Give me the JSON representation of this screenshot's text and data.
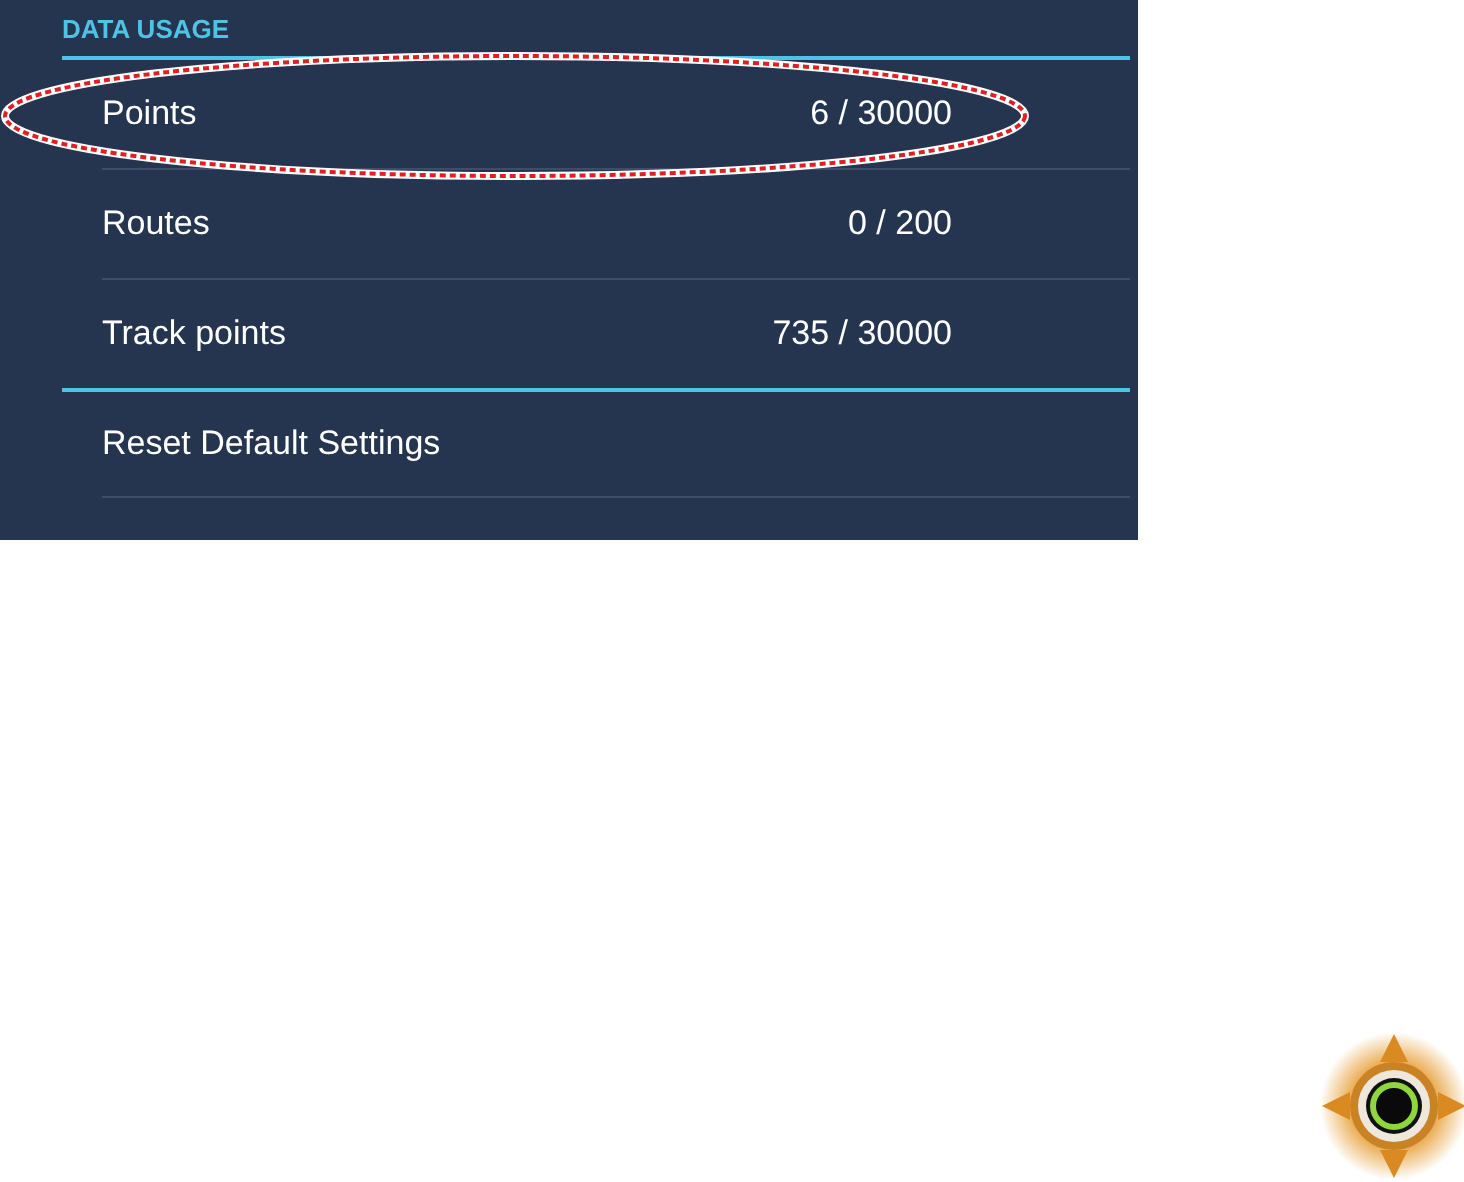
{
  "section": {
    "title": "DATA USAGE",
    "rows": [
      {
        "label": "Points",
        "value": "6 / 30000",
        "highlighted": true
      },
      {
        "label": "Routes",
        "value": "0 / 200",
        "highlighted": false
      },
      {
        "label": "Track points",
        "value": "735 / 30000",
        "highlighted": false
      }
    ]
  },
  "actions": [
    {
      "label": "Reset Default Settings"
    }
  ]
}
